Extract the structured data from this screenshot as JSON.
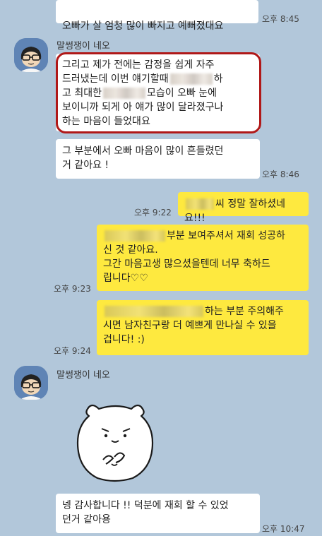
{
  "colors": {
    "background": "#b2c7da",
    "incoming_bubble": "#ffffff",
    "outgoing_bubble": "#fee93f",
    "highlight": "#b01818"
  },
  "messages": {
    "m1": {
      "text": "오빠가 살 엄청 많이 빠지고 예뻐졌대요",
      "time": "오후 8:45"
    },
    "sender_1": "말썽쟁이 네오",
    "m2": {
      "text": "그리고 제가 전에는 감정을 쉽게 자주\n드러냈는데 이번 얘기할때\n하고 최대한\n보이니까 되게 아 얘가 많이 달라졌구나\n 하는 마음이 들었대요",
      "line2_start": "드러냈는데 이번 얘기할때",
      "line2_end": "하",
      "line3_start": "고 최대한",
      "line3_end": "모습이 오빠 눈에",
      "line4": "보이니까 되게 아 얘가 많이 달라졌구나",
      "line5": " 하는 마음이 들었대요",
      "line1": "그리고 제가 전에는 감정을 쉽게 자주"
    },
    "m3": {
      "line1": "그 부분에서 오빠 마음이 많이 흔들렸던",
      "line2": "거 같아요 !",
      "time": "오후 8:46"
    },
    "m4": {
      "text": "씨 정말 잘하셨네요!!!",
      "time": "오후 9:22"
    },
    "m5": {
      "line1_end": "부분 보여주셔서 재회 성공하",
      "line2": "신 것 같아요.",
      "line3": "그간 마음고생 많으셨을텐데 너무 축하드",
      "line4": "립니다♡♡",
      "time": "오후 9:23"
    },
    "m6": {
      "line1_end": "하는 부분 주의해주",
      "line2": "시면 남자친구랑 더 예쁘게 만나실 수 있을",
      "line3": "겁니다! :)",
      "time": "오후 9:24"
    },
    "sender_2": "말썽쟁이 네오",
    "m7": {
      "line1": "넹 감사합니다 !! 덕분에 재회 할 수 있었",
      "line2": "던거 같아용",
      "time": "오후 10:47"
    }
  }
}
